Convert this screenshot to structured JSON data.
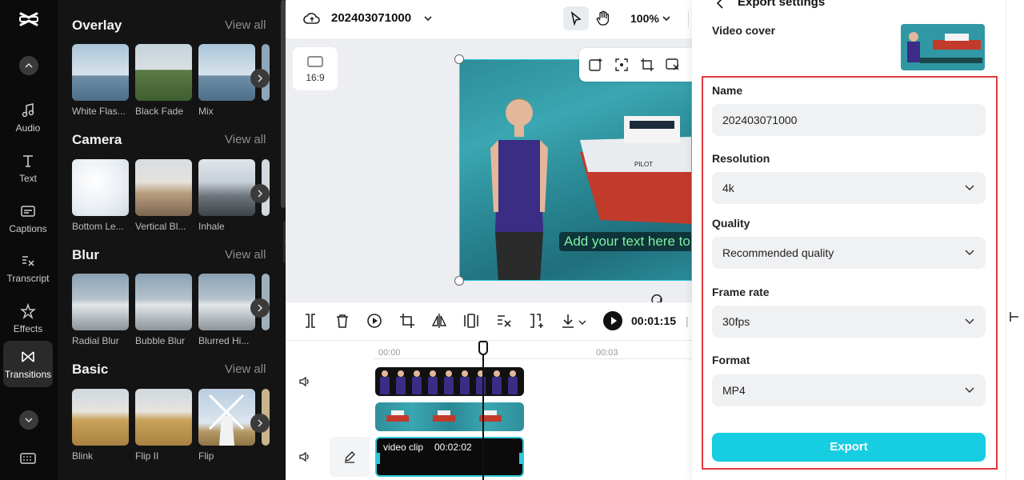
{
  "sidebar": {
    "items": [
      {
        "label": "Audio",
        "icon": "music-note-icon"
      },
      {
        "label": "Text",
        "icon": "text-icon"
      },
      {
        "label": "Captions",
        "icon": "captions-icon"
      },
      {
        "label": "Transcript",
        "icon": "transcript-icon"
      },
      {
        "label": "Effects",
        "icon": "effects-icon"
      },
      {
        "label": "Transitions",
        "icon": "transitions-icon",
        "active": true
      }
    ]
  },
  "panel": {
    "sections": [
      {
        "title": "Overlay",
        "view_all": "View all",
        "items": [
          "White Flas...",
          "Black Fade",
          "Mix"
        ]
      },
      {
        "title": "Camera",
        "view_all": "View all",
        "items": [
          "Bottom Le...",
          "Vertical Bl...",
          "Inhale"
        ]
      },
      {
        "title": "Blur",
        "view_all": "View all",
        "items": [
          "Radial Blur",
          "Bubble Blur",
          "Blurred Hi..."
        ]
      },
      {
        "title": "Basic",
        "view_all": "View all",
        "items": [
          "Blink",
          "Flip II",
          "Flip"
        ]
      }
    ]
  },
  "topbar": {
    "project_name": "202403071000",
    "zoom": "100%"
  },
  "canvas": {
    "ratio": "16:9",
    "caption_text": "Add your text here to"
  },
  "toolbar": {
    "current_time": "00:01:15",
    "separator": "|"
  },
  "timeline": {
    "ruler": [
      "00:00",
      "00:03"
    ],
    "clip_label": "video clip",
    "clip_duration": "00:02:02"
  },
  "export": {
    "title": "Export settings",
    "video_cover_label": "Video cover",
    "name_label": "Name",
    "name_value": "202403071000",
    "resolution_label": "Resolution",
    "resolution_value": "4k",
    "quality_label": "Quality",
    "quality_value": "Recommended quality",
    "frame_rate_label": "Frame rate",
    "frame_rate_value": "30fps",
    "format_label": "Format",
    "format_value": "MP4",
    "export_button": "Export"
  },
  "colors": {
    "accent": "#16cde2",
    "highlight_border": "#e0393e",
    "panel_bg": "#141414"
  }
}
